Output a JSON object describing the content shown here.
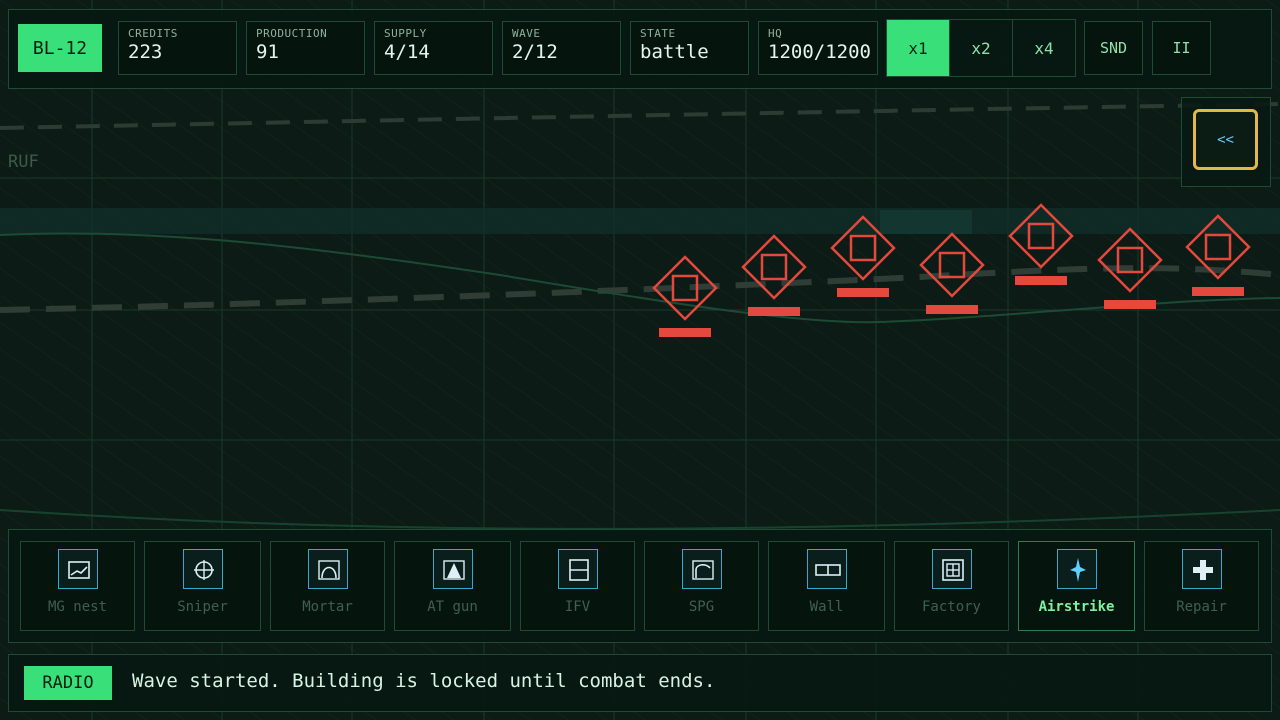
{
  "hud": {
    "map_id": "BL-12",
    "stats": [
      {
        "label": "CREDITS",
        "value": "223"
      },
      {
        "label": "PRODUCTION",
        "value": "91"
      },
      {
        "label": "SUPPLY",
        "value": "4/14"
      },
      {
        "label": "WAVE",
        "value": "2/12"
      },
      {
        "label": "STATE",
        "value": "battle"
      },
      {
        "label": "HQ",
        "value": "1200/1200"
      }
    ],
    "speed": {
      "options": [
        "x1",
        "x2",
        "x4"
      ],
      "selected": "x1"
    },
    "sound_label": "SND",
    "pause_label": "II"
  },
  "map": {
    "zone_label": "RUF",
    "collapse_label": "<<",
    "enemy_color": "#e5483d",
    "enemies_visible": 7
  },
  "build_menu": {
    "items": [
      {
        "label": "MG nest",
        "icon": "mg-nest-icon"
      },
      {
        "label": "Sniper",
        "icon": "crosshair-icon"
      },
      {
        "label": "Mortar",
        "icon": "mortar-arc-icon"
      },
      {
        "label": "AT gun",
        "icon": "at-gun-icon"
      },
      {
        "label": "IFV",
        "icon": "ifv-icon"
      },
      {
        "label": "SPG",
        "icon": "spg-icon"
      },
      {
        "label": "Wall",
        "icon": "wall-icon"
      },
      {
        "label": "Factory",
        "icon": "factory-icon"
      },
      {
        "label": "Airstrike",
        "icon": "airstrike-icon"
      },
      {
        "label": "Repair",
        "icon": "repair-cross-icon"
      }
    ],
    "selected": "Airstrike"
  },
  "radio": {
    "badge": "RADIO",
    "message": "Wave started. Building is locked until combat ends."
  }
}
